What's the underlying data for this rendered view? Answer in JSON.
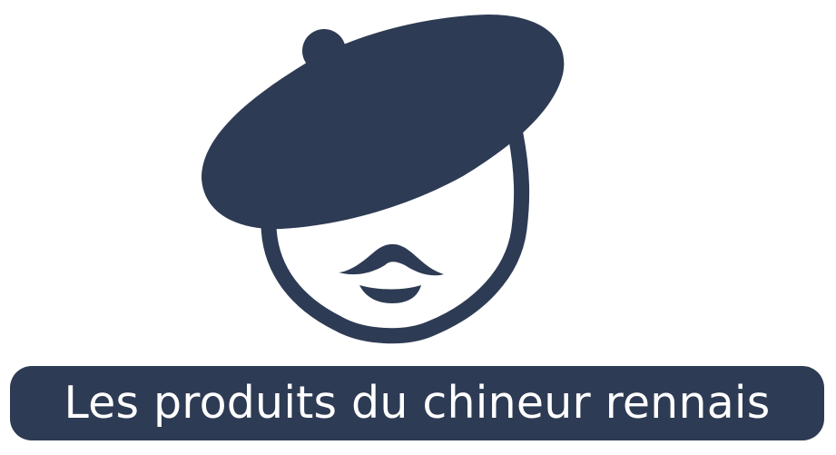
{
  "logo": {
    "icon": "beret-man-icon",
    "brand_color": "#2e3b54",
    "background_color": "#ffffff",
    "text_color": "#ffffff",
    "banner_text": "Les produits du chineur rennais"
  }
}
